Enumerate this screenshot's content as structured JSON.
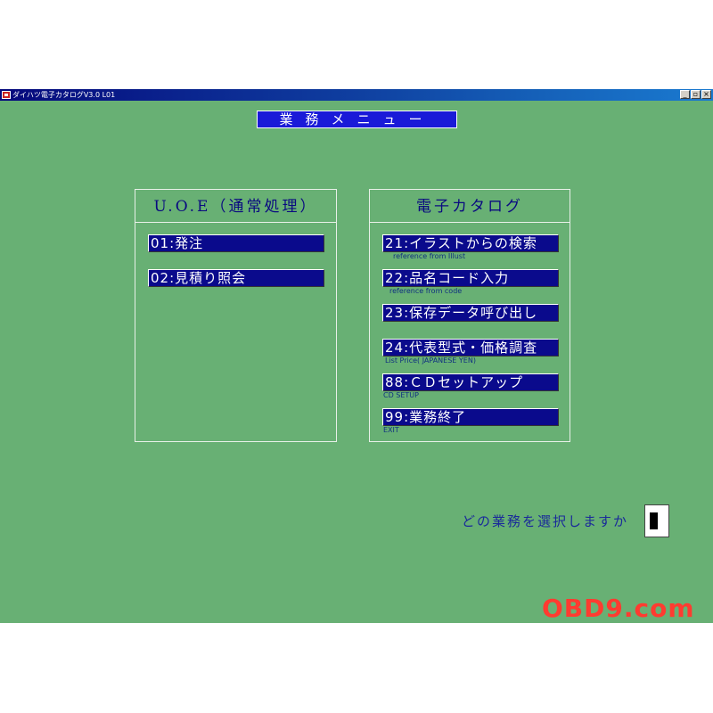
{
  "window": {
    "title": "ダイハツ電子カタログV3.0 L01",
    "controls": {
      "minimize": "_",
      "maximize": "▫",
      "close": "×"
    }
  },
  "menu_title": "業務メニュー",
  "uoe_panel": {
    "header": "U.O.E（通常処理）",
    "items": [
      {
        "label": "01:発注"
      },
      {
        "label": "02:見積り照会"
      }
    ]
  },
  "catalog_panel": {
    "header": "電子カタログ",
    "items": [
      {
        "label": "21:イラストからの検索",
        "sub": "reference from Illust"
      },
      {
        "label": "22:品名コード入力",
        "sub": "reference from code"
      },
      {
        "label": "23:保存データ呼び出し",
        "sub": ""
      },
      {
        "label": "24:代表型式・価格調査",
        "sub": "List Price( JAPANESE YEN)"
      },
      {
        "label": "88:ＣＤセットアップ",
        "sub": "CD SETUP"
      },
      {
        "label": "99:業務終了",
        "sub": "EXIT"
      }
    ]
  },
  "prompt": {
    "text": "どの業務を選択しますか",
    "value": ""
  },
  "watermark": "OBD9.com",
  "colors": {
    "background": "#68b074",
    "item_bg": "#0a0a8c",
    "menu_title_bg": "#1a1ad8",
    "watermark": "#ff3b30"
  }
}
